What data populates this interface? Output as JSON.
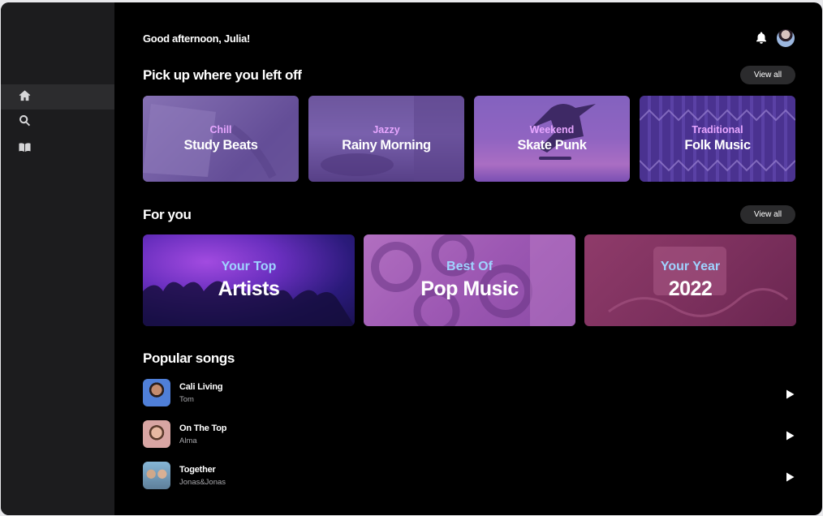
{
  "nav": {
    "items": [
      {
        "name": "home-icon",
        "active": true
      },
      {
        "name": "search-icon",
        "active": false
      },
      {
        "name": "library-icon",
        "active": false
      }
    ]
  },
  "header": {
    "greeting": "Good afternoon, Julia!",
    "icons": [
      "bell-icon",
      "user-avatar"
    ]
  },
  "pickup": {
    "title": "Pick up where you left off",
    "view_all": "View all",
    "cards": [
      {
        "label": "Chill",
        "title": "Study Beats"
      },
      {
        "label": "Jazzy",
        "title": "Rainy Morning"
      },
      {
        "label": "Weekend",
        "title": "Skate Punk"
      },
      {
        "label": "Traditional",
        "title": "Folk Music"
      }
    ]
  },
  "foryou": {
    "title": "For you",
    "view_all": "View all",
    "cards": [
      {
        "label": "Your Top",
        "title": "Artists"
      },
      {
        "label": "Best Of",
        "title": "Pop Music"
      },
      {
        "label": "Your Year",
        "title": "2022"
      }
    ]
  },
  "popular": {
    "title": "Popular songs",
    "songs": [
      {
        "title": "Cali Living",
        "artist": "Tom"
      },
      {
        "title": "On The Top",
        "artist": "Alma"
      },
      {
        "title": "Together",
        "artist": "Jonas&Jonas"
      }
    ]
  },
  "colors": {
    "background": "#000000",
    "sidebar": "#1c1c1e",
    "label_pink": "#e7a6ff",
    "label_blue": "#9fd3ff"
  }
}
